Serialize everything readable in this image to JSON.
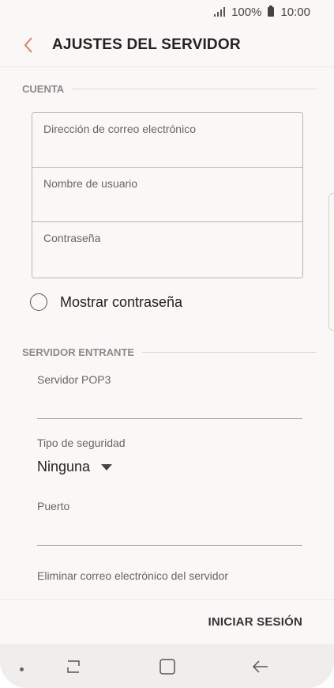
{
  "status_bar": {
    "battery": "100%",
    "time": "10:00"
  },
  "header": {
    "title": "AJUSTES DEL SERVIDOR",
    "back_icon": "chevron-left-icon"
  },
  "account_section": {
    "title": "CUENTA",
    "email_placeholder": "Dirección de correo electrónico",
    "username_placeholder": "Nombre de usuario",
    "password_placeholder": "Contraseña",
    "show_password_label": "Mostrar contraseña"
  },
  "incoming_section": {
    "title": "SERVIDOR ENTRANTE",
    "pop3_label": "Servidor POP3",
    "pop3_value": "",
    "security_label": "Tipo de seguridad",
    "security_value": "Ninguna",
    "port_label": "Puerto",
    "port_value": "",
    "delete_label": "Eliminar correo electrónico del servidor"
  },
  "actions": {
    "login_label": "INICIAR SESIÓN"
  },
  "colors": {
    "accent": "#e8805a",
    "background": "#faf8f6"
  },
  "nav": {
    "recent_icon": "recent-apps-icon",
    "home_icon": "home-icon",
    "back_icon": "back-arrow-icon"
  }
}
